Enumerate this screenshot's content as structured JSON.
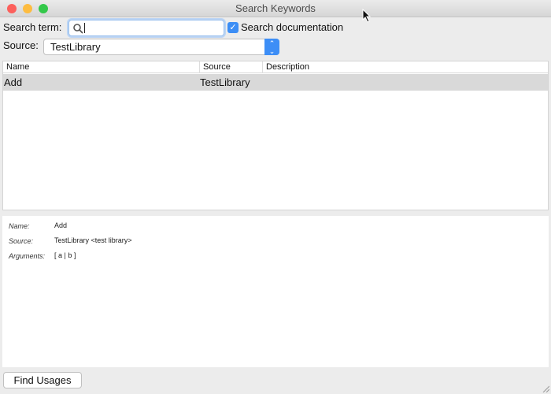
{
  "window": {
    "title": "Search Keywords"
  },
  "search": {
    "label": "Search term:",
    "value": "",
    "search_documentation_label": "Search documentation",
    "search_documentation_checked": true
  },
  "source": {
    "label": "Source:",
    "selected": "TestLibrary"
  },
  "table": {
    "columns": [
      "Name",
      "Source",
      "Description"
    ],
    "rows": [
      {
        "name": "Add",
        "source": "TestLibrary",
        "description": ""
      }
    ]
  },
  "details": {
    "name_label": "Name:",
    "name": "Add",
    "source_label": "Source:",
    "source": "TestLibrary <test library>",
    "arguments_label": "Arguments:",
    "arguments": "[ a | b ]"
  },
  "footer": {
    "find_usages_label": "Find Usages"
  }
}
